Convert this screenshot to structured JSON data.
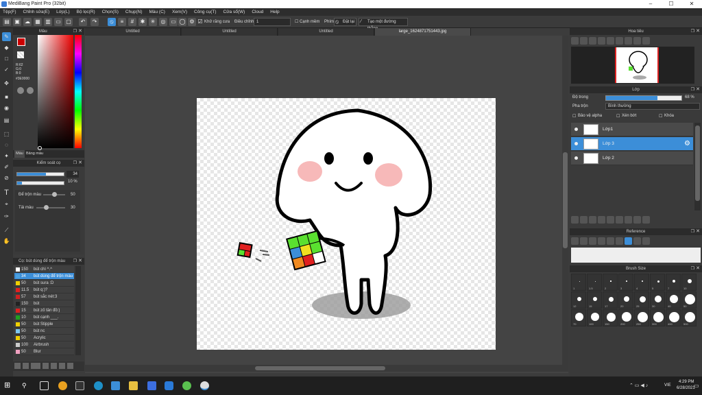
{
  "window": {
    "title": "MediBang Paint Pro (32bit)",
    "min": "–",
    "max": "☐",
    "close": "✕"
  },
  "menu": [
    "Tệp(F)",
    "Chỉnh sửa(E)",
    "Lớp(L)",
    "Bộ lọc(R)",
    "Chọn(S)",
    "Chụp(N)",
    "Màu (C)",
    "Xem(V)",
    "Công cụ(T)",
    "Cửa sổ(W)",
    "Cloud",
    "Help"
  ],
  "toolbar": {
    "antialias_label": "Khử răng cưa",
    "correction_label": "Điều chỉnh",
    "correction_value": "1",
    "edge_label": "Cạnh mềm",
    "pen_label": "Phím",
    "cancel_label": "Đặt lại",
    "straight_label": "Tạo một đường thẳng"
  },
  "color_panel": {
    "title": "Màu",
    "r": "R:62",
    "g": "G:0",
    "b": "B:0",
    "hex": "#3E0000",
    "tab_color": "Màu",
    "tab_palette": "Bảng màu",
    "accent": "#3c8ed8"
  },
  "brush_control": {
    "title": "Kiểm soát cọ",
    "size_value": "34",
    "size_fraction": 0.62,
    "opacity_value": "10 %",
    "opacity_fraction": 0.1,
    "blend_label": "Để trộn màu",
    "blend_value": "50",
    "blend_fraction": 0.5,
    "mix_label": "Tải màu",
    "mix_value": "30",
    "mix_fraction": 0.3
  },
  "brush_list": {
    "title": "Cọ: bút dùng để trộn màu",
    "items": [
      {
        "size": "150",
        "name": "bút chì ^.^",
        "color": "#ffffff"
      },
      {
        "size": "34",
        "name": "bút dùng để trộn màu",
        "color": "#4aa0e0",
        "selected": true
      },
      {
        "size": "50",
        "name": "bút sura :D",
        "color": "#f0d000"
      },
      {
        "size": "11.5",
        "name": "bút q:)?",
        "color": "#e02020"
      },
      {
        "size": "57",
        "name": "bút sắc nét:3",
        "color": "#d02020"
      },
      {
        "size": "150",
        "name": "bút",
        "color": "#222222"
      },
      {
        "size": "15",
        "name": "bút zố tân đồ:)",
        "color": "#e02020"
      },
      {
        "size": "10",
        "name": "bút cạnh ___.",
        "color": "#20a020"
      },
      {
        "size": "50",
        "name": "bút Stipple",
        "color": "#f0d000"
      },
      {
        "size": "50",
        "name": "bút nc",
        "color": "#7ec8f0"
      },
      {
        "size": "50",
        "name": "Acrylic",
        "color": "#f0d000"
      },
      {
        "size": "100",
        "name": "Airbrush",
        "color": "#cccccc"
      },
      {
        "size": "50",
        "name": "Blur",
        "color": "#f0a0c0"
      }
    ]
  },
  "tabs": [
    "Untitled",
    "Untitled",
    "Untitled",
    "large_1624871751443.jpg"
  ],
  "navigator": {
    "title": "Hoa tiêu"
  },
  "layers": {
    "title": "Lớp",
    "opacity_label": "Độ trong",
    "opacity_value": "68 %",
    "opacity_fraction": 0.68,
    "blend_label": "Pha trộn",
    "blend_value": "Bình thường",
    "protect_alpha": "Bảo vệ alpha",
    "clipping": "Xén bớt",
    "lock": "Khóa",
    "items": [
      "Lớp1",
      "Lớp 3",
      "Lớp 2"
    ],
    "selected_index": 1
  },
  "reference": {
    "title": "Reference"
  },
  "brush_size": {
    "title": "Brush Size",
    "row1": [
      "1",
      "1.5",
      "2",
      "3",
      "4",
      "5",
      "7",
      "10"
    ],
    "row2": [
      "12",
      "15",
      "17",
      "20",
      "25",
      "30",
      "40",
      "50"
    ],
    "row3": [
      "70",
      "100",
      "150",
      "200",
      "250",
      "300",
      "400",
      "500"
    ]
  },
  "taskbar": {
    "lang": "VIE",
    "time": "4:29 PM",
    "date": "6/28/2021"
  }
}
